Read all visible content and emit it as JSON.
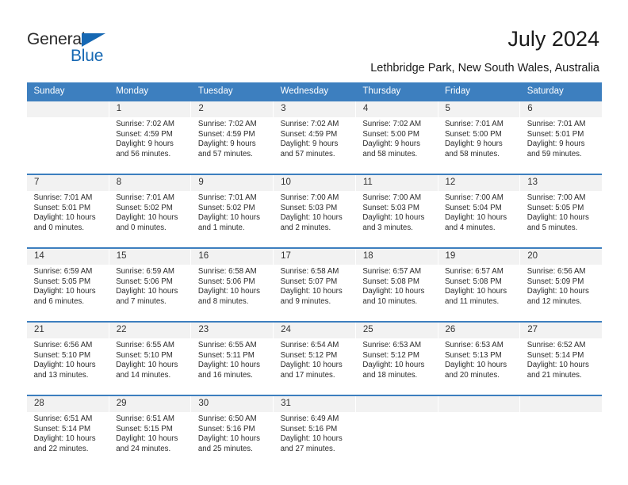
{
  "logo": {
    "word1": "General",
    "word2": "Blue",
    "triangle_color": "#1668b3",
    "icon": "triangle-icon"
  },
  "header": {
    "title": "July 2024",
    "subtitle": "Lethbridge Park, New South Wales, Australia"
  },
  "theme": {
    "header_bg": "#3d7fbf",
    "header_text": "#ffffff",
    "daynum_bg": "#f2f2f2",
    "cell_bg": "#ffffff",
    "text": "#2b2b2b"
  },
  "calendar": {
    "weekday_headers": [
      "Sunday",
      "Monday",
      "Tuesday",
      "Wednesday",
      "Thursday",
      "Friday",
      "Saturday"
    ],
    "weeks": [
      [
        {
          "day": "",
          "sunrise": "",
          "sunset": "",
          "daylight1": "",
          "daylight2": ""
        },
        {
          "day": "1",
          "sunrise": "Sunrise: 7:02 AM",
          "sunset": "Sunset: 4:59 PM",
          "daylight1": "Daylight: 9 hours",
          "daylight2": "and 56 minutes."
        },
        {
          "day": "2",
          "sunrise": "Sunrise: 7:02 AM",
          "sunset": "Sunset: 4:59 PM",
          "daylight1": "Daylight: 9 hours",
          "daylight2": "and 57 minutes."
        },
        {
          "day": "3",
          "sunrise": "Sunrise: 7:02 AM",
          "sunset": "Sunset: 4:59 PM",
          "daylight1": "Daylight: 9 hours",
          "daylight2": "and 57 minutes."
        },
        {
          "day": "4",
          "sunrise": "Sunrise: 7:02 AM",
          "sunset": "Sunset: 5:00 PM",
          "daylight1": "Daylight: 9 hours",
          "daylight2": "and 58 minutes."
        },
        {
          "day": "5",
          "sunrise": "Sunrise: 7:01 AM",
          "sunset": "Sunset: 5:00 PM",
          "daylight1": "Daylight: 9 hours",
          "daylight2": "and 58 minutes."
        },
        {
          "day": "6",
          "sunrise": "Sunrise: 7:01 AM",
          "sunset": "Sunset: 5:01 PM",
          "daylight1": "Daylight: 9 hours",
          "daylight2": "and 59 minutes."
        }
      ],
      [
        {
          "day": "7",
          "sunrise": "Sunrise: 7:01 AM",
          "sunset": "Sunset: 5:01 PM",
          "daylight1": "Daylight: 10 hours",
          "daylight2": "and 0 minutes."
        },
        {
          "day": "8",
          "sunrise": "Sunrise: 7:01 AM",
          "sunset": "Sunset: 5:02 PM",
          "daylight1": "Daylight: 10 hours",
          "daylight2": "and 0 minutes."
        },
        {
          "day": "9",
          "sunrise": "Sunrise: 7:01 AM",
          "sunset": "Sunset: 5:02 PM",
          "daylight1": "Daylight: 10 hours",
          "daylight2": "and 1 minute."
        },
        {
          "day": "10",
          "sunrise": "Sunrise: 7:00 AM",
          "sunset": "Sunset: 5:03 PM",
          "daylight1": "Daylight: 10 hours",
          "daylight2": "and 2 minutes."
        },
        {
          "day": "11",
          "sunrise": "Sunrise: 7:00 AM",
          "sunset": "Sunset: 5:03 PM",
          "daylight1": "Daylight: 10 hours",
          "daylight2": "and 3 minutes."
        },
        {
          "day": "12",
          "sunrise": "Sunrise: 7:00 AM",
          "sunset": "Sunset: 5:04 PM",
          "daylight1": "Daylight: 10 hours",
          "daylight2": "and 4 minutes."
        },
        {
          "day": "13",
          "sunrise": "Sunrise: 7:00 AM",
          "sunset": "Sunset: 5:05 PM",
          "daylight1": "Daylight: 10 hours",
          "daylight2": "and 5 minutes."
        }
      ],
      [
        {
          "day": "14",
          "sunrise": "Sunrise: 6:59 AM",
          "sunset": "Sunset: 5:05 PM",
          "daylight1": "Daylight: 10 hours",
          "daylight2": "and 6 minutes."
        },
        {
          "day": "15",
          "sunrise": "Sunrise: 6:59 AM",
          "sunset": "Sunset: 5:06 PM",
          "daylight1": "Daylight: 10 hours",
          "daylight2": "and 7 minutes."
        },
        {
          "day": "16",
          "sunrise": "Sunrise: 6:58 AM",
          "sunset": "Sunset: 5:06 PM",
          "daylight1": "Daylight: 10 hours",
          "daylight2": "and 8 minutes."
        },
        {
          "day": "17",
          "sunrise": "Sunrise: 6:58 AM",
          "sunset": "Sunset: 5:07 PM",
          "daylight1": "Daylight: 10 hours",
          "daylight2": "and 9 minutes."
        },
        {
          "day": "18",
          "sunrise": "Sunrise: 6:57 AM",
          "sunset": "Sunset: 5:08 PM",
          "daylight1": "Daylight: 10 hours",
          "daylight2": "and 10 minutes."
        },
        {
          "day": "19",
          "sunrise": "Sunrise: 6:57 AM",
          "sunset": "Sunset: 5:08 PM",
          "daylight1": "Daylight: 10 hours",
          "daylight2": "and 11 minutes."
        },
        {
          "day": "20",
          "sunrise": "Sunrise: 6:56 AM",
          "sunset": "Sunset: 5:09 PM",
          "daylight1": "Daylight: 10 hours",
          "daylight2": "and 12 minutes."
        }
      ],
      [
        {
          "day": "21",
          "sunrise": "Sunrise: 6:56 AM",
          "sunset": "Sunset: 5:10 PM",
          "daylight1": "Daylight: 10 hours",
          "daylight2": "and 13 minutes."
        },
        {
          "day": "22",
          "sunrise": "Sunrise: 6:55 AM",
          "sunset": "Sunset: 5:10 PM",
          "daylight1": "Daylight: 10 hours",
          "daylight2": "and 14 minutes."
        },
        {
          "day": "23",
          "sunrise": "Sunrise: 6:55 AM",
          "sunset": "Sunset: 5:11 PM",
          "daylight1": "Daylight: 10 hours",
          "daylight2": "and 16 minutes."
        },
        {
          "day": "24",
          "sunrise": "Sunrise: 6:54 AM",
          "sunset": "Sunset: 5:12 PM",
          "daylight1": "Daylight: 10 hours",
          "daylight2": "and 17 minutes."
        },
        {
          "day": "25",
          "sunrise": "Sunrise: 6:53 AM",
          "sunset": "Sunset: 5:12 PM",
          "daylight1": "Daylight: 10 hours",
          "daylight2": "and 18 minutes."
        },
        {
          "day": "26",
          "sunrise": "Sunrise: 6:53 AM",
          "sunset": "Sunset: 5:13 PM",
          "daylight1": "Daylight: 10 hours",
          "daylight2": "and 20 minutes."
        },
        {
          "day": "27",
          "sunrise": "Sunrise: 6:52 AM",
          "sunset": "Sunset: 5:14 PM",
          "daylight1": "Daylight: 10 hours",
          "daylight2": "and 21 minutes."
        }
      ],
      [
        {
          "day": "28",
          "sunrise": "Sunrise: 6:51 AM",
          "sunset": "Sunset: 5:14 PM",
          "daylight1": "Daylight: 10 hours",
          "daylight2": "and 22 minutes."
        },
        {
          "day": "29",
          "sunrise": "Sunrise: 6:51 AM",
          "sunset": "Sunset: 5:15 PM",
          "daylight1": "Daylight: 10 hours",
          "daylight2": "and 24 minutes."
        },
        {
          "day": "30",
          "sunrise": "Sunrise: 6:50 AM",
          "sunset": "Sunset: 5:16 PM",
          "daylight1": "Daylight: 10 hours",
          "daylight2": "and 25 minutes."
        },
        {
          "day": "31",
          "sunrise": "Sunrise: 6:49 AM",
          "sunset": "Sunset: 5:16 PM",
          "daylight1": "Daylight: 10 hours",
          "daylight2": "and 27 minutes."
        },
        {
          "day": "",
          "sunrise": "",
          "sunset": "",
          "daylight1": "",
          "daylight2": ""
        },
        {
          "day": "",
          "sunrise": "",
          "sunset": "",
          "daylight1": "",
          "daylight2": ""
        },
        {
          "day": "",
          "sunrise": "",
          "sunset": "",
          "daylight1": "",
          "daylight2": ""
        }
      ]
    ]
  }
}
